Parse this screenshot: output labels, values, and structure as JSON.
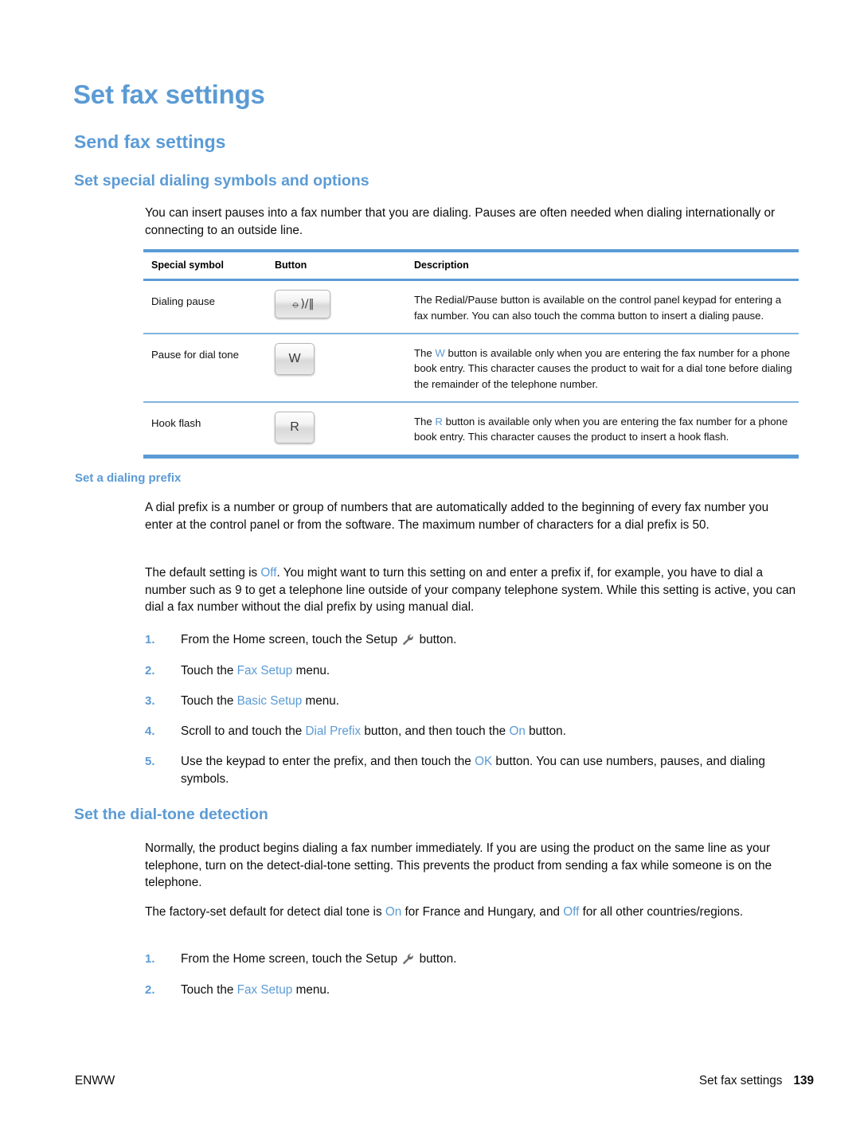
{
  "page": {
    "h1_title": "Set fax settings",
    "h2_title": "Send fax settings",
    "h3_title": "Set special dialing symbols and options",
    "intro_paragraph": "You can insert pauses into a fax number that you are dialing. Pauses are often needed when dialing internationally or connecting to an outside line."
  },
  "table": {
    "headers": [
      "Special symbol",
      "Button",
      "Description"
    ],
    "rows": [
      {
        "symbol": "Dialing pause",
        "button_icon": "redial-pause-icon",
        "button_glyph": "⦵)/‖",
        "description_pre": "The Redial/Pause button is available on the control panel keypad for entering a fax number. You can also touch the comma button to insert a dialing pause.",
        "highlight": "",
        "description_post": ""
      },
      {
        "symbol": "Pause for dial tone",
        "button_icon": "w-key-icon",
        "button_glyph": "W",
        "description_pre": "The ",
        "highlight": "W",
        "description_post": " button is available only when you are entering the fax number for a phone book entry. This character causes the product to wait for a dial tone before dialing the remainder of the telephone number."
      },
      {
        "symbol": "Hook flash",
        "button_icon": "r-key-icon",
        "button_glyph": "R",
        "description_pre": "The ",
        "highlight": "R",
        "description_post": " button is available only when you are entering the fax number for a phone book entry. This character causes the product to insert a hook flash."
      }
    ]
  },
  "dialing_prefix": {
    "heading": "Set a dialing prefix",
    "paragraph1": "A dial prefix is a number or group of numbers that are automatically added to the beginning of every fax number you enter at the control panel or from the software. The maximum number of characters for a dial prefix is 50.",
    "paragraph2_a": "The default setting is ",
    "paragraph2_off": "Off",
    "paragraph2_b": ". You might want to turn this setting on and enter a prefix if, for example, you have to dial a number such as 9 to get a telephone line outside of your company telephone system. While this setting is active, you can dial a fax number without the dial prefix by using manual dial.",
    "steps": [
      {
        "number": "1.",
        "text_a": "From the Home screen, touch the Setup ",
        "icon": "wrench-icon",
        "text_b": " button.",
        "highlight1": "",
        "highlight2": ""
      },
      {
        "number": "2.",
        "text_a": "Touch the ",
        "highlight1": "Fax Setup",
        "text_b": " menu.",
        "highlight2": ""
      },
      {
        "number": "3.",
        "text_a": "Touch the ",
        "highlight1": "Basic Setup",
        "text_b": " menu.",
        "highlight2": ""
      },
      {
        "number": "4.",
        "text_a": "Scroll to and touch the ",
        "highlight1": "Dial Prefix",
        "text_b": " button, and then touch the ",
        "highlight2": "On",
        "text_c": " button."
      },
      {
        "number": "5.",
        "text_a": "Use the keypad to enter the prefix, and then touch the ",
        "highlight1": "OK",
        "text_b": " button. You can use numbers, pauses, and dialing symbols.",
        "highlight2": ""
      }
    ]
  },
  "dial_tone": {
    "heading": "Set the dial-tone detection",
    "paragraph1": "Normally, the product begins dialing a fax number immediately. If you are using the product on the same line as your telephone, turn on the detect-dial-tone setting. This prevents the product from sending a fax while someone is on the telephone.",
    "paragraph2_a": "The factory-set default for detect dial tone is ",
    "paragraph2_on": "On",
    "paragraph2_b": " for France and Hungary, and ",
    "paragraph2_off": "Off",
    "paragraph2_c": " for all other countries/regions.",
    "steps": [
      {
        "number": "1.",
        "text_a": "From the Home screen, touch the Setup ",
        "icon": "wrench-icon",
        "text_b": " button.",
        "highlight1": ""
      },
      {
        "number": "2.",
        "text_a": "Touch the ",
        "highlight1": "Fax Setup",
        "text_b": " menu."
      }
    ]
  },
  "footer": {
    "left": "ENWW",
    "right_title": "Set fax settings",
    "page_number": "139"
  },
  "colors": {
    "heading_blue": "#5B9BD5",
    "rule_blue": "#5B9BD5",
    "row_rule_blue": "#7FB4DE",
    "body_text": "#0d0d0d"
  }
}
